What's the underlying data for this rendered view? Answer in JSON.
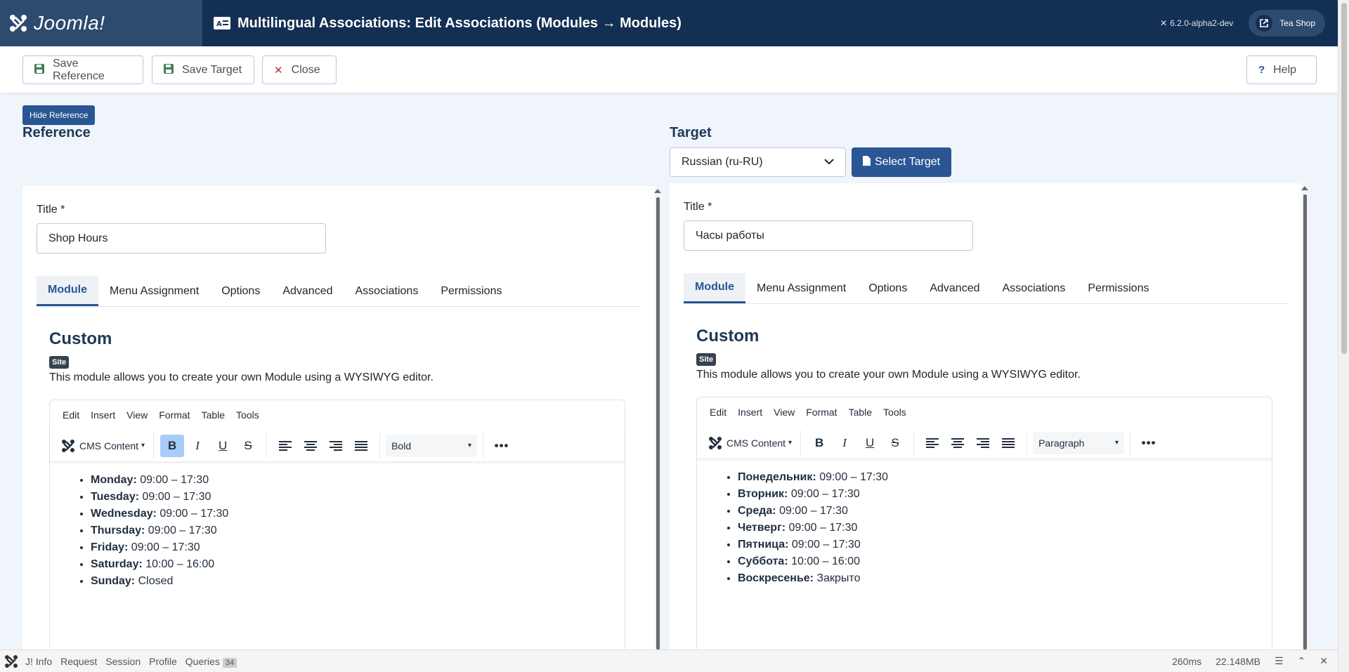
{
  "header": {
    "brand": "Joomla!",
    "title": "Multilingual Associations: Edit Associations (Modules → Modules)",
    "version": "6.2.0-alpha2-dev",
    "site_name": "Tea Shop"
  },
  "toolbar": {
    "save_reference": "Save Reference",
    "save_target": "Save Target",
    "close": "Close",
    "help": "Help"
  },
  "reference": {
    "hide_button": "Hide Reference",
    "heading": "Reference",
    "title_label": "Title *",
    "title_value": "Shop Hours",
    "tabs": [
      "Module",
      "Menu Assignment",
      "Options",
      "Advanced",
      "Associations",
      "Permissions"
    ],
    "module_type": "Custom",
    "badge": "Site",
    "description": "This module allows you to create your own Module using a WYSIWYG editor.",
    "editor_menu": [
      "Edit",
      "Insert",
      "View",
      "Format",
      "Table",
      "Tools"
    ],
    "cms_content": "CMS Content",
    "block_format": "Bold",
    "hours": [
      {
        "day": "Monday:",
        "time": "09:00 – 17:30"
      },
      {
        "day": "Tuesday:",
        "time": "09:00 – 17:30"
      },
      {
        "day": "Wednesday:",
        "time": "09:00 – 17:30"
      },
      {
        "day": "Thursday:",
        "time": "09:00 – 17:30"
      },
      {
        "day": "Friday:",
        "time": "09:00 – 17:30"
      },
      {
        "day": "Saturday:",
        "time": "10:00 – 16:00"
      },
      {
        "day": "Sunday:",
        "time": "Closed"
      }
    ]
  },
  "target": {
    "heading": "Target",
    "language": "Russian (ru-RU)",
    "select_button": "Select Target",
    "title_label": "Title *",
    "title_value": "Часы работы",
    "tabs": [
      "Module",
      "Menu Assignment",
      "Options",
      "Advanced",
      "Associations",
      "Permissions"
    ],
    "module_type": "Custom",
    "badge": "Site",
    "description": "This module allows you to create your own Module using a WYSIWYG editor.",
    "editor_menu": [
      "Edit",
      "Insert",
      "View",
      "Format",
      "Table",
      "Tools"
    ],
    "cms_content": "CMS Content",
    "block_format": "Paragraph",
    "hours": [
      {
        "day": "Понедельник:",
        "time": "09:00 – 17:30"
      },
      {
        "day": "Вторник:",
        "time": "09:00 – 17:30"
      },
      {
        "day": "Среда:",
        "time": "09:00 – 17:30"
      },
      {
        "day": "Четверг:",
        "time": "09:00 – 17:30"
      },
      {
        "day": "Пятница:",
        "time": "09:00 – 17:30"
      },
      {
        "day": "Суббота:",
        "time": "10:00 – 16:00"
      },
      {
        "day": "Воскресенье:",
        "time": "Закрыто"
      }
    ]
  },
  "debug": {
    "links": [
      "J! Info",
      "Request",
      "Session",
      "Profile",
      "Queries"
    ],
    "queries_count": "34",
    "time": "260ms",
    "memory": "22.148MB"
  },
  "colors": {
    "header_bg": "#132f53",
    "brand_bg": "#2d4a6f",
    "primary": "#2a5693",
    "save_icon": "#457d54",
    "close_icon": "#c52827"
  }
}
